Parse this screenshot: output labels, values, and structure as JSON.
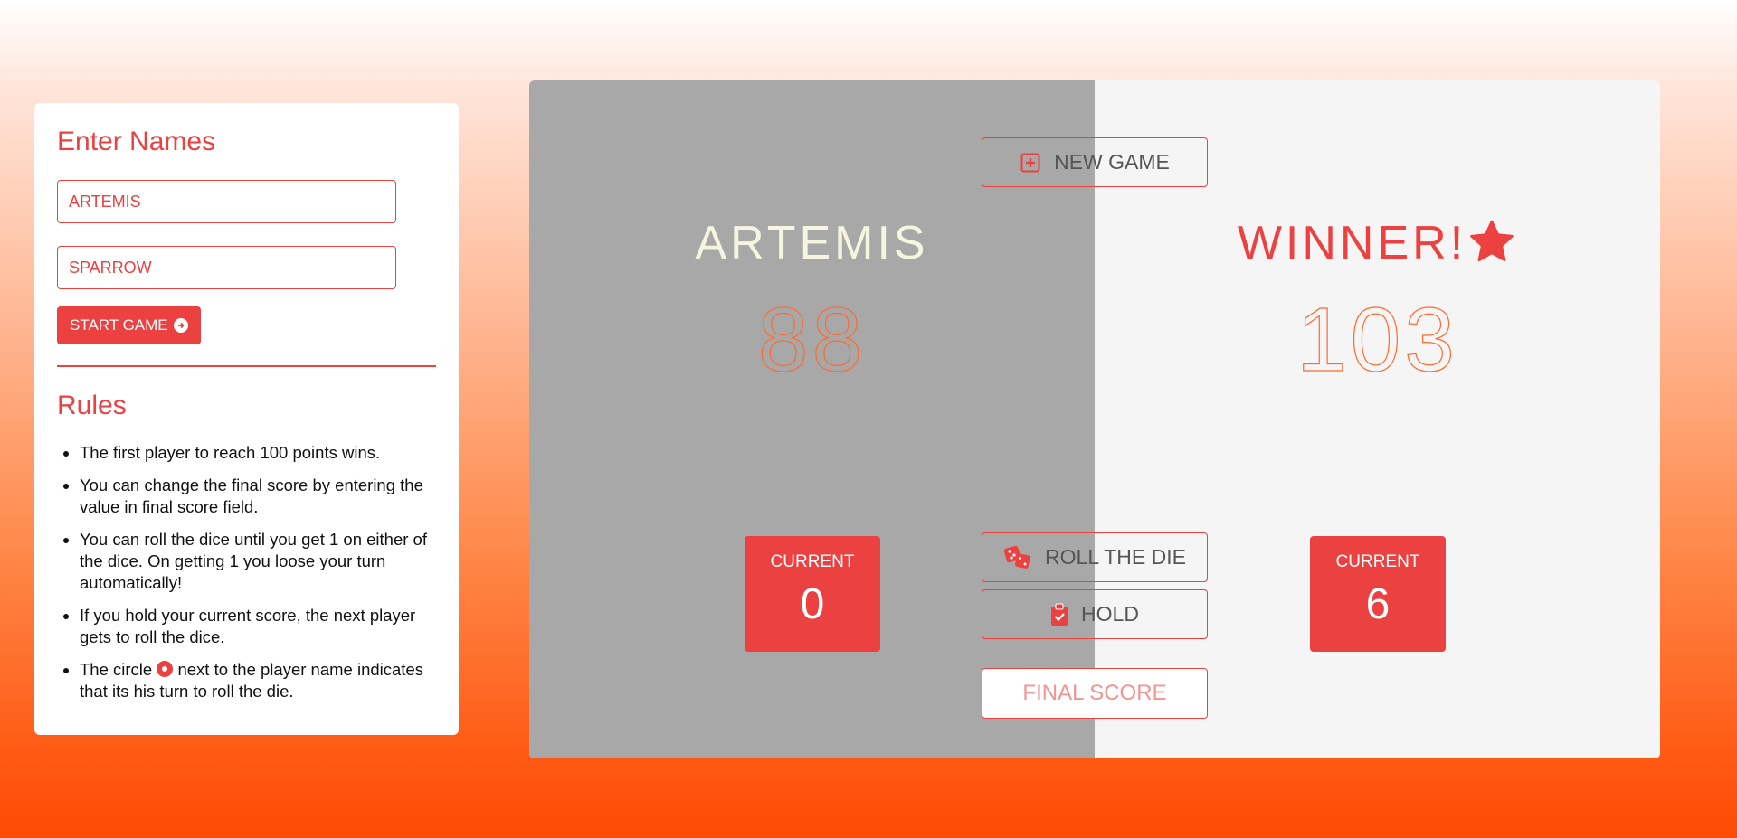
{
  "sidebar": {
    "names_heading": "Enter Names",
    "player1_value": "ARTEMIS",
    "player2_value": "SPARROW",
    "start_button": "START GAME",
    "rules_heading": "Rules",
    "rules": [
      "The first player to reach 100 points wins.",
      "You can change the final score by entering the value in final score field.",
      "You can roll the dice until you get 1 on either of the dice. On getting 1 you loose your turn automatically!",
      "If you hold your current score, the next player gets to roll the dice."
    ],
    "rule5_before": "The circle",
    "rule5_after": "next to the player name indicates that its his turn to roll the die."
  },
  "board": {
    "player1": {
      "name": "ARTEMIS",
      "score": "88",
      "current_label": "CURRENT",
      "current_value": "0"
    },
    "player2": {
      "name": "WINNER!",
      "score": "103",
      "current_label": "CURRENT",
      "current_value": "6"
    },
    "new_game_label": "NEW GAME",
    "roll_label": "ROLL THE DIE",
    "hold_label": "HOLD",
    "final_score_placeholder": "FINAL SCORE"
  },
  "colors": {
    "accent": "#eb4141",
    "active_panel": "#a8a8a8",
    "inactive_panel": "#f5f5f5",
    "score_orange": "#ff6a2e"
  },
  "icons": {
    "new_game": "plus-square-icon",
    "roll": "dice-icon",
    "hold": "clipboard-check-icon",
    "winner": "star-icon",
    "start": "arrow-circle-right-icon"
  }
}
